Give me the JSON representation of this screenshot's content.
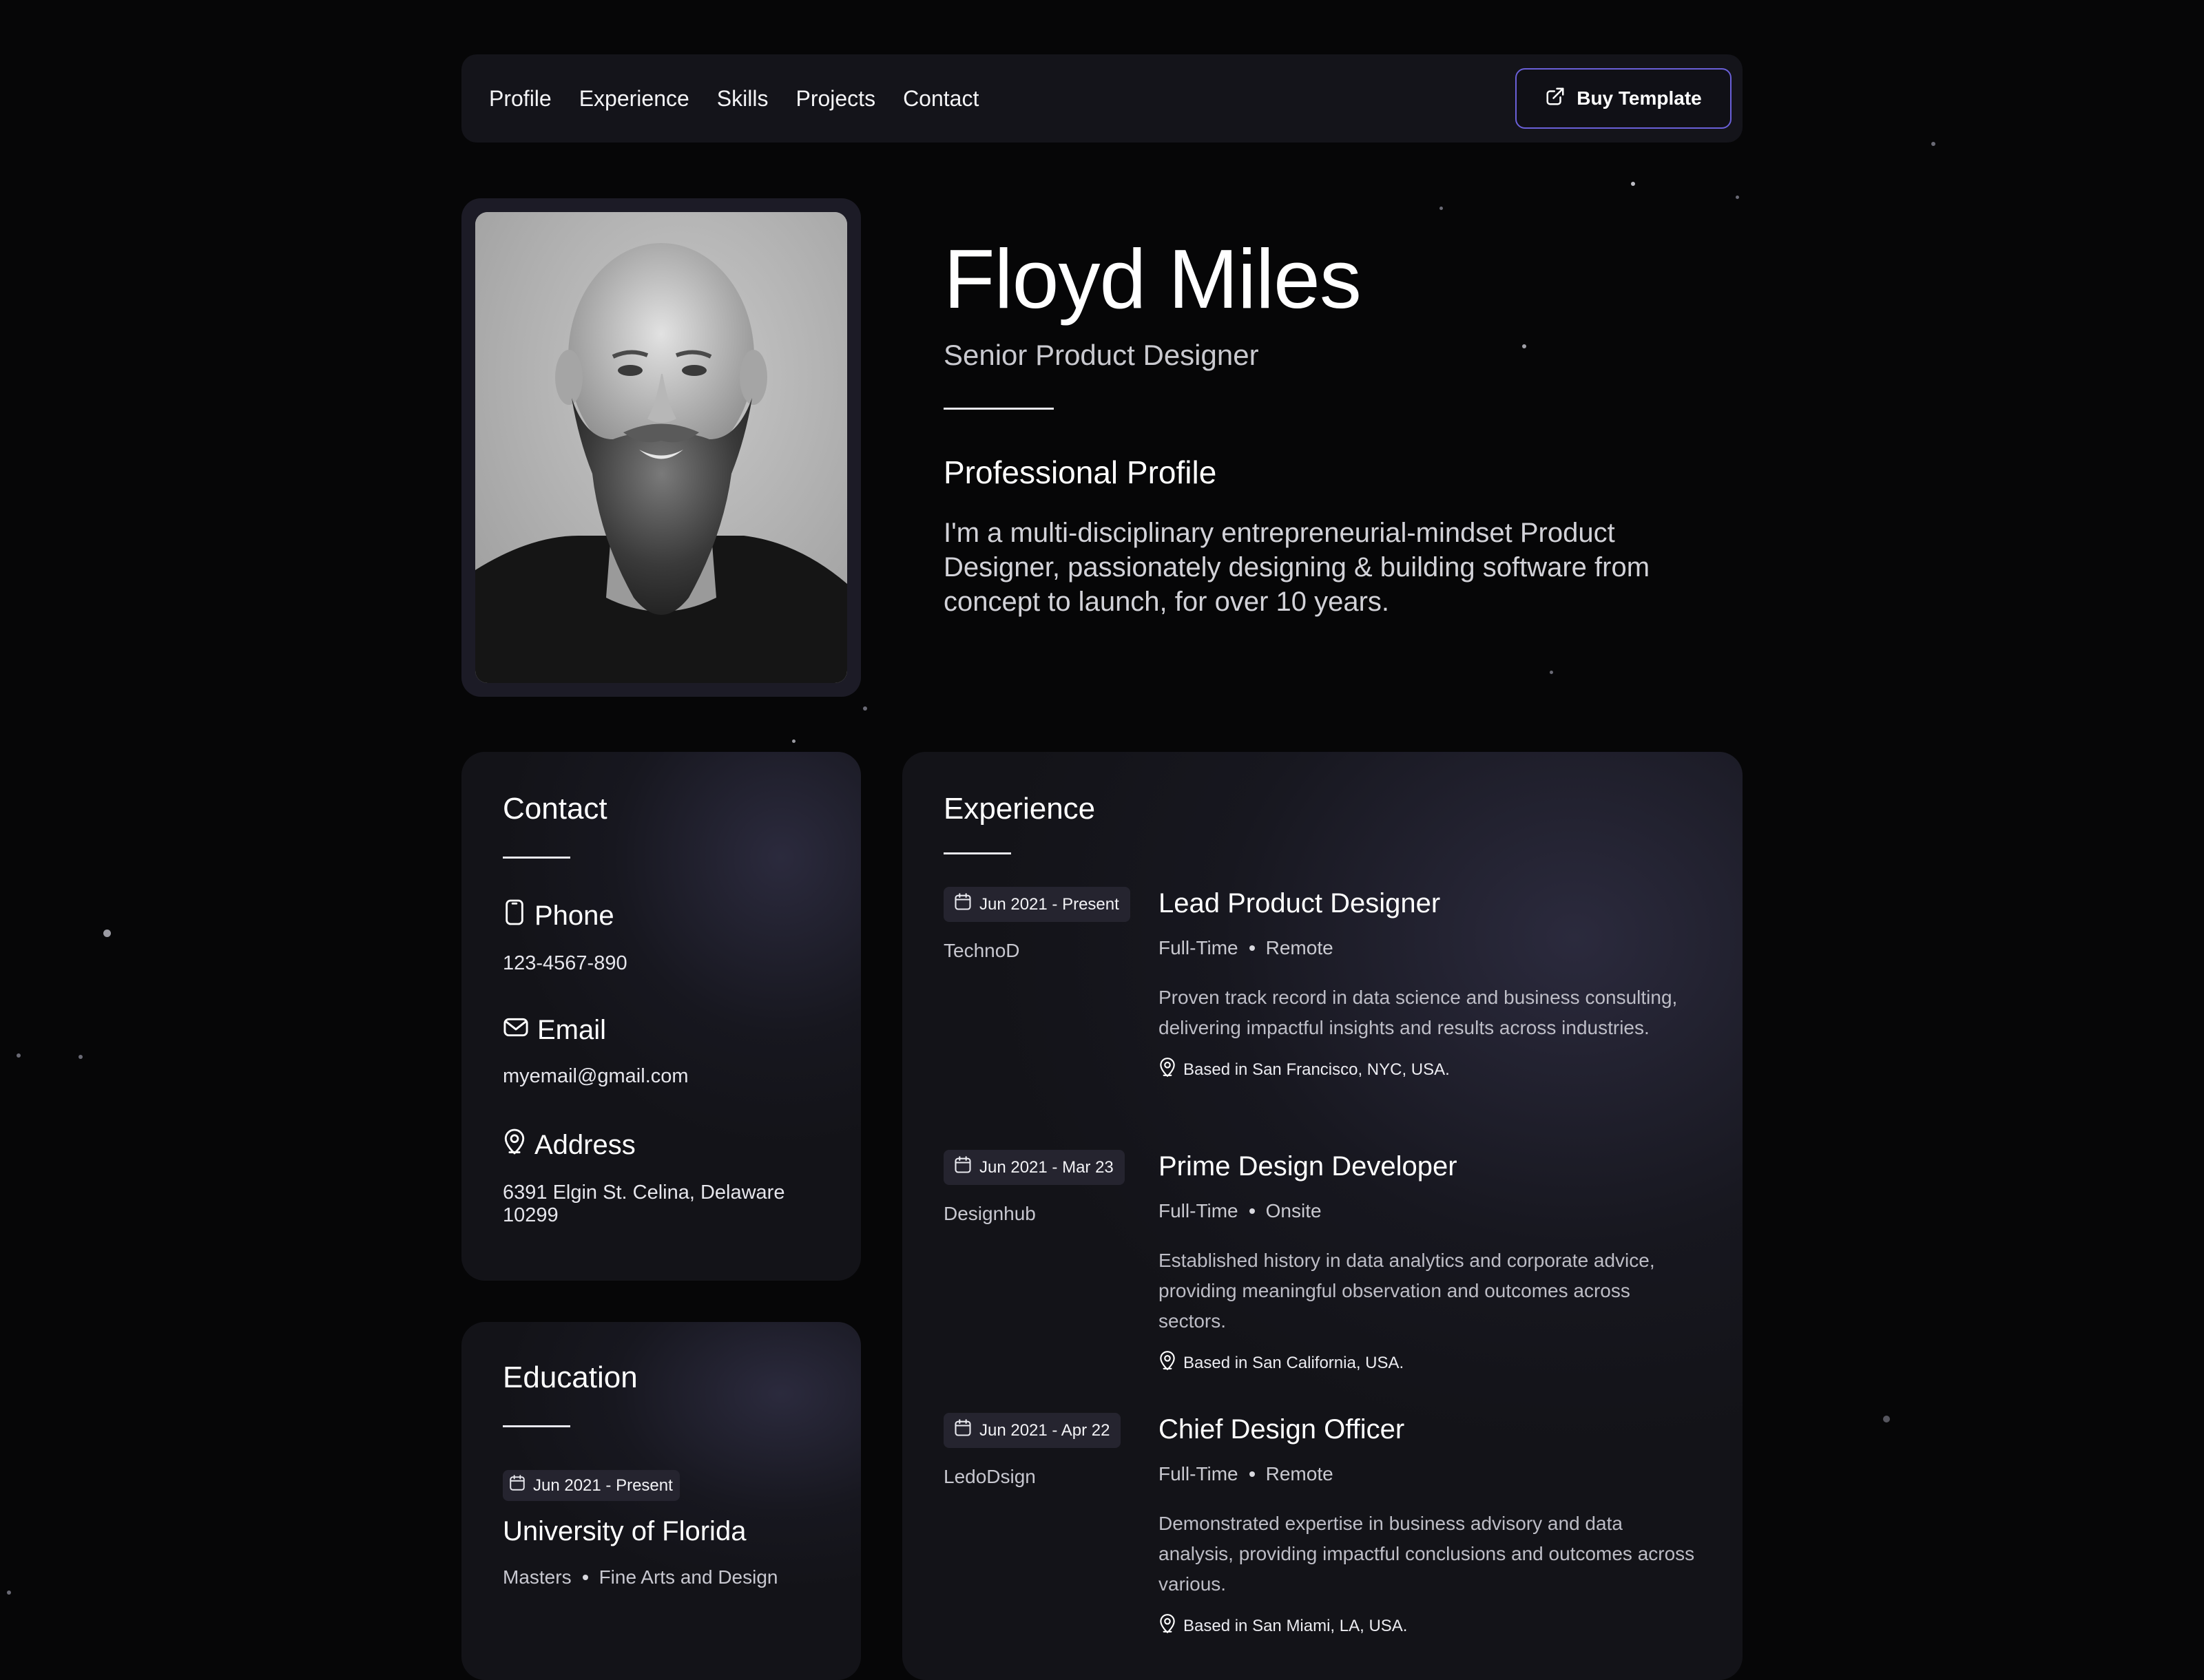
{
  "nav": {
    "links": [
      "Profile",
      "Experience",
      "Skills",
      "Projects",
      "Contact"
    ],
    "cta_label": "Buy Template",
    "cta_icon": "external-link-icon",
    "accent_color": "#6a60d8"
  },
  "hero": {
    "name": "Floyd Miles",
    "role": "Senior Product Designer",
    "section_title": "Professional Profile",
    "bio": "I'm a multi-disciplinary entrepreneurial-mindset Product Designer, passionately designing & building software from concept to launch, for over 10 years."
  },
  "contact": {
    "title": "Contact",
    "items": [
      {
        "label": "Phone",
        "icon": "phone-icon",
        "value": "123-4567-890"
      },
      {
        "label": "Email",
        "icon": "mail-icon",
        "value": "myemail@gmail.com"
      },
      {
        "label": "Address",
        "icon": "map-pin-icon",
        "value": "6391 Elgin St. Celina, Delaware 10299"
      }
    ]
  },
  "education": {
    "title": "Education",
    "date": "Jun 2021 - Present",
    "school": "University of Florida",
    "degree": "Masters",
    "field": "Fine Arts and Design"
  },
  "experience": {
    "title": "Experience",
    "entries": [
      {
        "date": "Jun 2021 - Present",
        "company": "TechnoD",
        "title": "Lead Product Designer",
        "type": "Full-Time",
        "mode": "Remote",
        "description": "Proven track record in data science and business consulting, delivering impactful insights and results across industries.",
        "location": "Based in San Francisco, NYC, USA."
      },
      {
        "date": "Jun 2021 - Mar 23",
        "company": "Designhub",
        "title": "Prime Design Developer",
        "type": "Full-Time",
        "mode": "Onsite",
        "description": "Established history in data analytics and corporate advice, providing meaningful observation and outcomes across sectors.",
        "location": "Based in San California, USA."
      },
      {
        "date": "Jun 2021 - Apr 22",
        "company": "LedoDsign",
        "title": "Chief Design Officer",
        "type": "Full-Time",
        "mode": "Remote",
        "description": "Demonstrated expertise in business advisory and data analysis, providing impactful conclusions and outcomes across various.",
        "location": "Based in San Miami, LA, USA."
      }
    ]
  }
}
